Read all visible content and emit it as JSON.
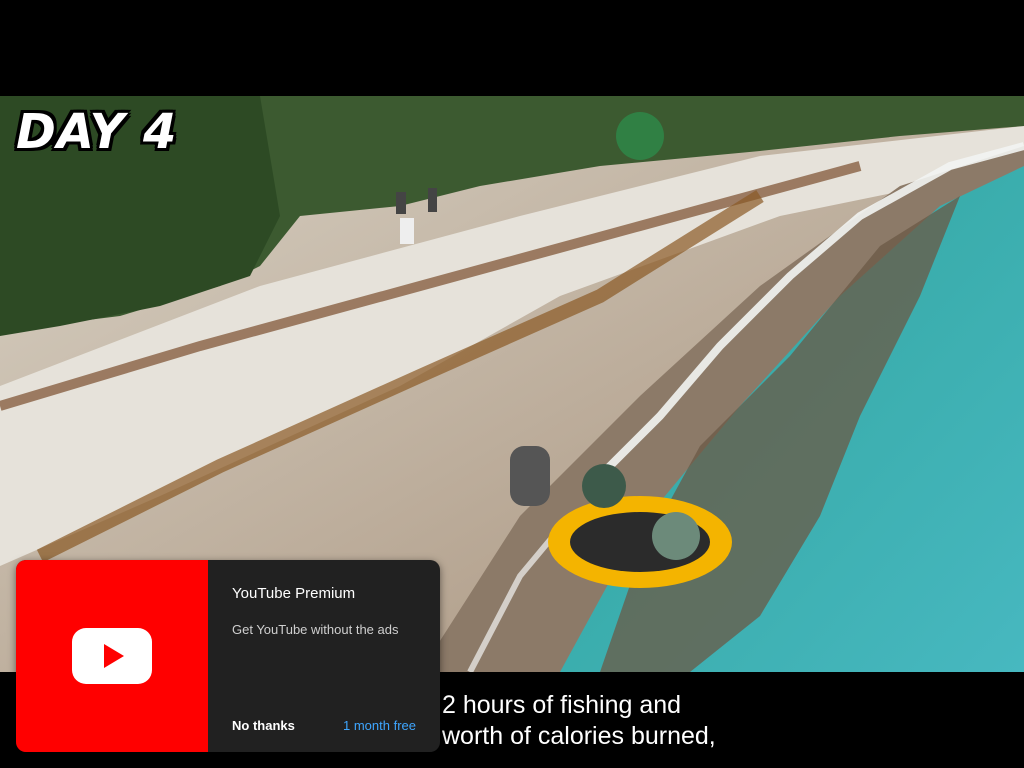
{
  "video": {
    "overlay_text": "DAY 4",
    "captions": [
      "2 hours of fishing and",
      "worth of calories burned,"
    ]
  },
  "promo": {
    "icon": "youtube-play-icon",
    "title": "YouTube Premium",
    "subtitle": "Get YouTube without the ads",
    "decline_label": "No thanks",
    "accept_label": "1 month free",
    "brand_color": "#ff0000",
    "accent_color": "#3ea6ff"
  }
}
